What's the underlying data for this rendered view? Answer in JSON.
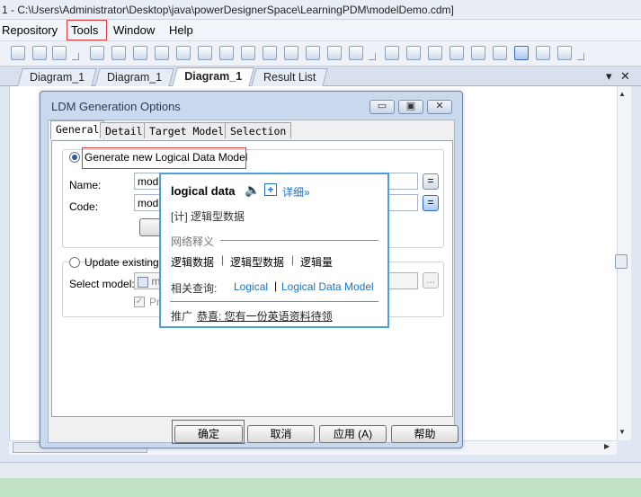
{
  "window": {
    "title": "1 - C:\\Users\\Administrator\\Desktop\\java\\powerDesignerSpace\\LearningPDM\\modelDemo.cdm]"
  },
  "menu": [
    "Repository",
    "Tools",
    "Window",
    "Help"
  ],
  "tabs": [
    "Diagram_1",
    "Diagram_1",
    "Diagram_1",
    "Result List"
  ],
  "tab_controls": {
    "dropdown": "▾",
    "close": "✕"
  },
  "dialog": {
    "title": "LDM Generation Options",
    "tabs": [
      "General",
      "Detail",
      "Target Models",
      "Selection"
    ],
    "generate_label": "Generate new Logical Data Model",
    "name_label": "Name:",
    "name_value": "mode",
    "code_label": "Code:",
    "code_value": "mode",
    "config_button": "Co",
    "update_label": "Update existing Lo",
    "select_model_label": "Select model:",
    "select_model_value": "m",
    "preserve_label": "Pre",
    "buttons": {
      "ok": "确定",
      "cancel": "取消",
      "apply": "应用 (A)",
      "help": "帮助"
    },
    "ellipsis": "..."
  },
  "popup": {
    "word": "logical data",
    "more": "详细»",
    "definition": "[计] 逻辑型数据",
    "web_section": "网络释义",
    "web_items": [
      "逻辑数据",
      "逻辑型数据",
      "逻辑量"
    ],
    "related_label": "相关查询:",
    "related_items": [
      "Logical",
      "Logical Data Model"
    ],
    "promo_label": "推广",
    "promo_text": "恭喜: 您有一份英语资料待领"
  },
  "colors": {
    "accent": "#4aa0d8",
    "highlight_box": "#e23a3a",
    "link": "#1a73c9"
  }
}
